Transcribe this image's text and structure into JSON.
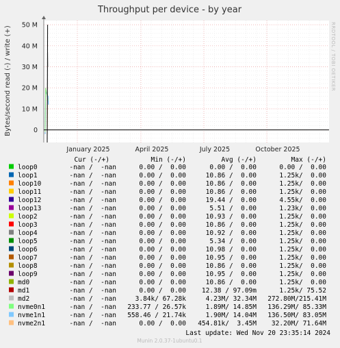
{
  "chart_data": {
    "type": "line",
    "title": "Throughput per device - by year",
    "ylabel": "Bytes/second read (-) / write (+)",
    "side_label": "RRDTOOL / TOBI OETIKER",
    "ylim": [
      -6000000,
      52000000
    ],
    "y_ticks": [
      {
        "label": "50 M",
        "value": 50000000
      },
      {
        "label": "40 M",
        "value": 40000000
      },
      {
        "label": "30 M",
        "value": 30000000
      },
      {
        "label": "20 M",
        "value": 20000000
      },
      {
        "label": "10 M",
        "value": 10000000
      },
      {
        "label": "0",
        "value": 0
      }
    ],
    "x_ticks": [
      "January 2025",
      "April 2025",
      "July 2025",
      "October 2025"
    ],
    "series": [
      {
        "name": "nvme1n1",
        "color": "#66a9e6",
        "x": [
          "Nov 2024 wk3",
          "Nov 2024 wk3",
          "Nov 2024 wk4",
          "Nov 2024 wk4"
        ],
        "values": [
          -2000000,
          18000000,
          16000000,
          12000000
        ]
      },
      {
        "name": "nvme0n1",
        "color": "#89e27e",
        "x": [
          "Nov 2024 wk3",
          "Nov 2024 wk3",
          "Nov 2024 wk4"
        ],
        "values": [
          -1000000,
          20000000,
          14000000
        ]
      },
      {
        "name": "nvme2n1",
        "color": "#ffb870",
        "x": [
          "Nov 2024 wk4",
          "Nov 2024 wk4"
        ],
        "values": [
          -3000000,
          12000000
        ]
      },
      {
        "name": "md2",
        "color": "#aaaaaa",
        "x": [
          "Nov 2024 wk4",
          "Nov 2024 wk4",
          "Nov 2024 wk4"
        ],
        "values": [
          -5000000,
          37000000,
          30000000
        ]
      },
      {
        "name": "md1",
        "color": "#000000",
        "x": [
          "Nov 2024 wk4",
          "Nov 2024 wk4"
        ],
        "values": [
          -6000000,
          50000000
        ]
      }
    ]
  },
  "legend": {
    "headers": {
      "cur": "Cur (-/+)",
      "min": "Min (-/+)",
      "avg": "Avg (-/+)",
      "max": "Max (-/+)"
    },
    "rows": [
      {
        "name": "loop0",
        "color": "#00cc00",
        "cur": "-nan /  -nan",
        "min": "0.00 /  0.00",
        "avg": "0.00 /  0.00",
        "max": "0.00 /  0.00"
      },
      {
        "name": "loop1",
        "color": "#0066b3",
        "cur": "-nan /  -nan",
        "min": "0.00 /  0.00",
        "avg": "10.86 /  0.00",
        "max": "1.25k/  0.00"
      },
      {
        "name": "loop10",
        "color": "#ff8000",
        "cur": "-nan /  -nan",
        "min": "0.00 /  0.00",
        "avg": "10.86 /  0.00",
        "max": "1.25k/  0.00"
      },
      {
        "name": "loop11",
        "color": "#ffcc00",
        "cur": "-nan /  -nan",
        "min": "0.00 /  0.00",
        "avg": "10.86 /  0.00",
        "max": "1.25k/  0.00"
      },
      {
        "name": "loop12",
        "color": "#330099",
        "cur": "-nan /  -nan",
        "min": "0.00 /  0.00",
        "avg": "19.44 /  0.00",
        "max": "4.55k/  0.00"
      },
      {
        "name": "loop13",
        "color": "#990099",
        "cur": "-nan /  -nan",
        "min": "0.00 /  0.00",
        "avg": "5.51 /  0.00",
        "max": "1.23k/  0.00"
      },
      {
        "name": "loop2",
        "color": "#ccff00",
        "cur": "-nan /  -nan",
        "min": "0.00 /  0.00",
        "avg": "10.93 /  0.00",
        "max": "1.25k/  0.00"
      },
      {
        "name": "loop3",
        "color": "#ff0000",
        "cur": "-nan /  -nan",
        "min": "0.00 /  0.00",
        "avg": "10.86 /  0.00",
        "max": "1.25k/  0.00"
      },
      {
        "name": "loop4",
        "color": "#808080",
        "cur": "-nan /  -nan",
        "min": "0.00 /  0.00",
        "avg": "10.92 /  0.00",
        "max": "1.25k/  0.00"
      },
      {
        "name": "loop5",
        "color": "#008f00",
        "cur": "-nan /  -nan",
        "min": "0.00 /  0.00",
        "avg": "5.34 /  0.00",
        "max": "1.25k/  0.00"
      },
      {
        "name": "loop6",
        "color": "#00487d",
        "cur": "-nan /  -nan",
        "min": "0.00 /  0.00",
        "avg": "10.98 /  0.00",
        "max": "1.25k/  0.00"
      },
      {
        "name": "loop7",
        "color": "#b35a00",
        "cur": "-nan /  -nan",
        "min": "0.00 /  0.00",
        "avg": "10.95 /  0.00",
        "max": "1.25k/  0.00"
      },
      {
        "name": "loop8",
        "color": "#b38f00",
        "cur": "-nan /  -nan",
        "min": "0.00 /  0.00",
        "avg": "10.86 /  0.00",
        "max": "1.25k/  0.00"
      },
      {
        "name": "loop9",
        "color": "#6b006b",
        "cur": "-nan /  -nan",
        "min": "0.00 /  0.00",
        "avg": "10.95 /  0.00",
        "max": "1.25k/  0.00"
      },
      {
        "name": "md0",
        "color": "#8fb300",
        "cur": "-nan /  -nan",
        "min": "0.00 /  0.00",
        "avg": "10.86 /  0.00",
        "max": "1.25k/  0.00"
      },
      {
        "name": "md1",
        "color": "#b30000",
        "cur": "-nan /  -nan",
        "min": "0.00 /  0.00",
        "avg": "12.38 / 97.09m",
        "max": "1.25k/ 75.52"
      },
      {
        "name": "md2",
        "color": "#bebebe",
        "cur": "-nan /  -nan",
        "min": "3.84k/ 67.28k",
        "avg": "4.23M/ 32.34M",
        "max": "272.80M/215.41M"
      },
      {
        "name": "nvme0n1",
        "color": "#80ff80",
        "cur": "-nan /  -nan",
        "min": "233.77 / 26.57k",
        "avg": "1.89M/ 14.85M",
        "max": "136.29M/ 85.33M"
      },
      {
        "name": "nvme1n1",
        "color": "#80c9ff",
        "cur": "-nan /  -nan",
        "min": "558.46 / 21.74k",
        "avg": "1.90M/ 14.04M",
        "max": "136.50M/ 83.05M"
      },
      {
        "name": "nvme2n1",
        "color": "#ffc080",
        "cur": "-nan /  -nan",
        "min": "0.00 /  0.00",
        "avg": "454.81k/  3.45M",
        "max": "32.20M/ 71.64M"
      }
    ]
  },
  "last_update": "Last update: Wed Nov 20 23:35:14 2024",
  "footer": "Munin 2.0.37-1ubuntu0.1"
}
